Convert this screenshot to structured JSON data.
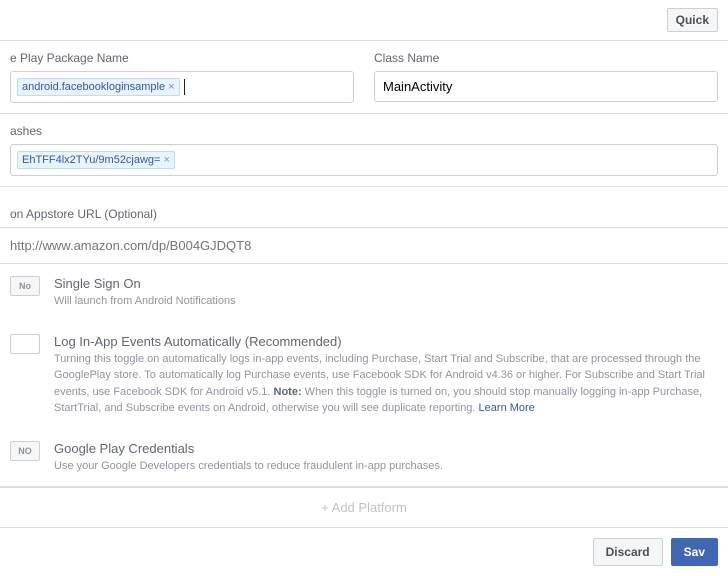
{
  "topbar": {
    "quick_label": "Quick"
  },
  "package_field": {
    "label": "e Play Package Name",
    "token": "android.facebookloginsample"
  },
  "class_field": {
    "label": "Class Name",
    "value": "MainActivity"
  },
  "hashes_field": {
    "label": "ashes",
    "token": "EhTFF4lx2TYu/9m52cjawg="
  },
  "appstore_field": {
    "label": "on Appstore URL (Optional)",
    "placeholder": "http://www.amazon.com/dp/B004GJDQT8"
  },
  "sso": {
    "toggle": "No",
    "title": "Single Sign On",
    "desc": "Will launch from Android Notifications"
  },
  "log_events": {
    "title": "Log In-App Events Automatically (Recommended)",
    "desc1": "Turning this toggle on automatically logs in-app events, including Purchase, Start Trial and Subscribe, that are processed through the GooglePlay store. To automatically log Purchase events, use Facebook SDK for Android v4.36 or higher. For Subscribe and Start Trial events, use Facebook SDK for Android v5.1. ",
    "note": "Note:",
    "desc2": " When this toggle is turned on, you should stop manually logging in-app Purchase, StartTrial, and Subscribe events on Android, otherwise you will see duplicate reporting. ",
    "link": "Learn More"
  },
  "gplay": {
    "toggle": "NO",
    "title": "Google Play Credentials",
    "desc": "Use your Google Developers credentials to reduce fraudulent in-app purchases."
  },
  "add_platform": "+ Add Platform",
  "footer": {
    "discard": "Discard",
    "save": "Sav"
  }
}
